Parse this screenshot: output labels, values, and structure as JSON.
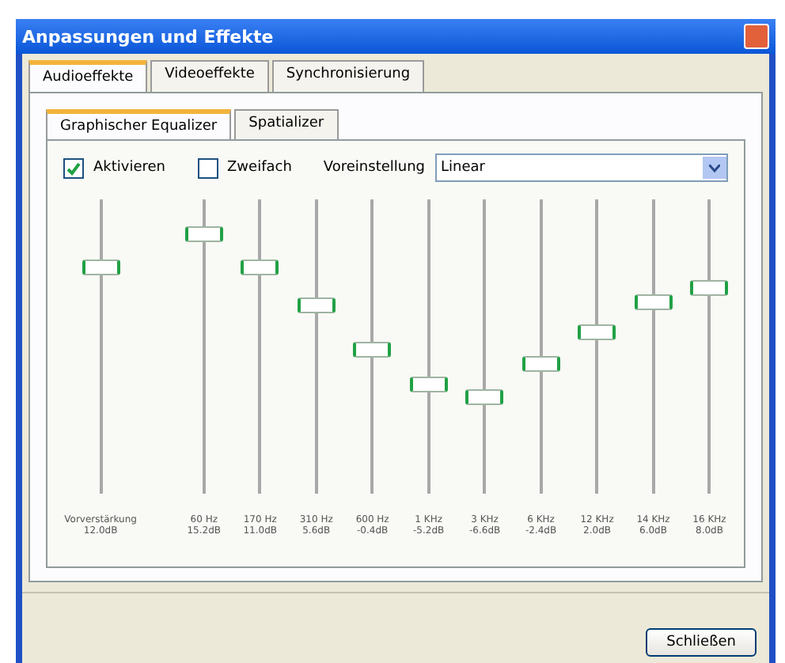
{
  "window": {
    "title": "Anpassungen und Effekte"
  },
  "tabs": [
    {
      "label": "Audioeffekte",
      "selected": true
    },
    {
      "label": "Videoeffekte",
      "selected": false
    },
    {
      "label": "Synchronisierung",
      "selected": false
    }
  ],
  "subtabs": [
    {
      "label": "Graphischer Equalizer",
      "selected": true
    },
    {
      "label": "Spatializer",
      "selected": false
    }
  ],
  "options": {
    "enable": {
      "label": "Aktivieren",
      "checked": true
    },
    "twopass": {
      "label": "Zweifach",
      "checked": false
    },
    "preset_label": "Voreinstellung",
    "preset": "Linear"
  },
  "preamp": {
    "label": "Vorverstärkung",
    "reading": "12.0dB",
    "level": 0.77
  },
  "bands": [
    {
      "label": "60 Hz",
      "reading": "15.2dB",
      "level": 0.88
    },
    {
      "label": "170 Hz",
      "reading": "11.0dB",
      "level": 0.77
    },
    {
      "label": "310 Hz",
      "reading": "5.6dB",
      "level": 0.64
    },
    {
      "label": "600 Hz",
      "reading": "-0.4dB",
      "level": 0.49
    },
    {
      "label": "1 KHz",
      "reading": "-5.2dB",
      "level": 0.37
    },
    {
      "label": "3 KHz",
      "reading": "-6.6dB",
      "level": 0.33
    },
    {
      "label": "6 KHz",
      "reading": "-2.4dB",
      "level": 0.44
    },
    {
      "label": "12 KHz",
      "reading": "2.0dB",
      "level": 0.55
    },
    {
      "label": "14 KHz",
      "reading": "6.0dB",
      "level": 0.65
    },
    {
      "label": "16 KHz",
      "reading": "8.0dB",
      "level": 0.7
    }
  ],
  "buttons": [
    {
      "label": "Schließen"
    }
  ]
}
